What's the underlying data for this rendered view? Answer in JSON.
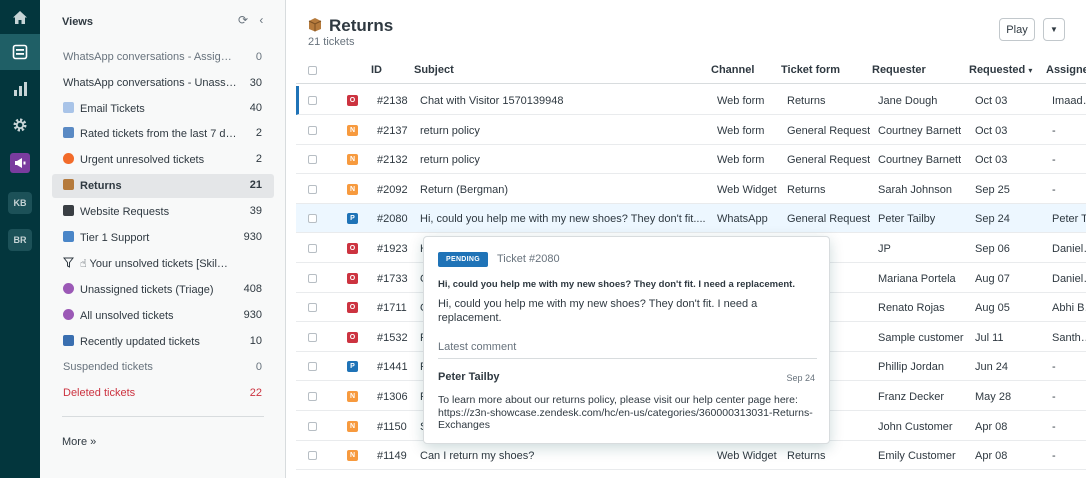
{
  "rail": {
    "kb": "KB",
    "br": "BR"
  },
  "views": {
    "title": "Views",
    "items": [
      {
        "label": "WhatsApp conversations - Assig…",
        "count": "0",
        "style": "muted"
      },
      {
        "label": "WhatsApp conversations - Unass…",
        "count": "30",
        "style": "plain"
      },
      {
        "label": "Email Tickets",
        "count": "40",
        "style": "plain",
        "icon": "email-icon"
      },
      {
        "label": "Rated tickets from the last 7 d…",
        "count": "2",
        "style": "plain",
        "icon": "chart-icon"
      },
      {
        "label": "Urgent unresolved tickets",
        "count": "2",
        "style": "plain",
        "icon": "fire-icon"
      },
      {
        "label": "Returns",
        "count": "21",
        "style": "selected",
        "icon": "package-icon"
      },
      {
        "label": "Website Requests",
        "count": "39",
        "style": "plain",
        "icon": "laptop-icon"
      },
      {
        "label": "Tier 1 Support",
        "count": "930",
        "style": "plain",
        "icon": "keycap-one-icon"
      },
      {
        "label": "☝ Your unsolved tickets [Skil…",
        "count": "",
        "style": "plain",
        "icon": "filter-icon"
      },
      {
        "label": "Unassigned tickets (Triage)",
        "count": "408",
        "style": "plain",
        "icon": "sparkle-icon"
      },
      {
        "label": "All unsolved tickets",
        "count": "930",
        "style": "plain",
        "icon": "sparkle-icon"
      },
      {
        "label": "Recently updated tickets",
        "count": "10",
        "style": "plain",
        "icon": "new-icon"
      },
      {
        "label": "Suspended tickets",
        "count": "0",
        "style": "muted"
      },
      {
        "label": "Deleted tickets",
        "count": "22",
        "style": "red"
      }
    ],
    "more": "More »"
  },
  "main": {
    "title": "Returns",
    "count": "21 tickets",
    "play": "Play"
  },
  "columns": [
    "ID",
    "Subject",
    "Channel",
    "Ticket form",
    "Requester",
    "Requested",
    "Assignee"
  ],
  "sort_indicator": "▾",
  "status_colors": {
    "O": "#cc3340",
    "N": "#f79a3e",
    "P": "#1f73b7"
  },
  "rows": [
    {
      "status": "O",
      "id": "#2138",
      "subject": "Chat with Visitor 1570139948",
      "channel": "Web form",
      "form": "Returns",
      "requester": "Jane Dough",
      "requested": "Oct 03",
      "assignee": "Imaadh S"
    },
    {
      "status": "N",
      "id": "#2137",
      "subject": "return policy",
      "channel": "Web form",
      "form": "General Request",
      "requester": "Courtney Barnett",
      "requested": "Oct 03",
      "assignee": "-"
    },
    {
      "status": "N",
      "id": "#2132",
      "subject": "return policy",
      "channel": "Web form",
      "form": "General Request",
      "requester": "Courtney Barnett",
      "requested": "Oct 03",
      "assignee": "-"
    },
    {
      "status": "N",
      "id": "#2092",
      "subject": "Return (Bergman)",
      "channel": "Web Widget",
      "form": "Returns",
      "requester": "Sarah Johnson",
      "requested": "Sep 25",
      "assignee": "-"
    },
    {
      "status": "P",
      "id": "#2080",
      "subject": "Hi, could you help me with my new shoes? They don't fit....",
      "channel": "WhatsApp",
      "form": "General Request",
      "requester": "Peter Tailby",
      "requested": "Sep 24",
      "assignee": "Peter Tai"
    },
    {
      "status": "O",
      "id": "#1923",
      "subject": "Hi",
      "channel": "",
      "form": "equest",
      "requester": "JP",
      "requested": "Sep 06",
      "assignee": "Daniel Ru"
    },
    {
      "status": "O",
      "id": "#1733",
      "subject": "Ol",
      "channel": "",
      "form": "atus",
      "requester": "Mariana Portela",
      "requested": "Aug 07",
      "assignee": "Daniel Ru"
    },
    {
      "status": "O",
      "id": "#1711",
      "subject": "Ol",
      "channel": "",
      "form": "",
      "requester": "Renato Rojas",
      "requested": "Aug 05",
      "assignee": "Abhi Bas"
    },
    {
      "status": "O",
      "id": "#1532",
      "subject": "Re",
      "channel": "",
      "form": "",
      "requester": "Sample customer",
      "requested": "Jul 11",
      "assignee": "Santhosh"
    },
    {
      "status": "P",
      "id": "#1441",
      "subject": "Fa",
      "channel": "",
      "form": "equest",
      "requester": "Phillip Jordan",
      "requested": "Jun 24",
      "assignee": "-"
    },
    {
      "status": "N",
      "id": "#1306",
      "subject": "Re",
      "channel": "",
      "form": "",
      "requester": "Franz Decker",
      "requested": "May 28",
      "assignee": "-"
    },
    {
      "status": "N",
      "id": "#1150",
      "subject": "Sh",
      "channel": "",
      "form": "",
      "requester": "John Customer",
      "requested": "Apr 08",
      "assignee": "-"
    },
    {
      "status": "N",
      "id": "#1149",
      "subject": "Can I return my shoes?",
      "channel": "Web Widget",
      "form": "Returns",
      "requester": "Emily Customer",
      "requested": "Apr 08",
      "assignee": "-"
    }
  ],
  "popover": {
    "status": "PENDING",
    "ticket": "Ticket #2080",
    "subject": "Hi, could you help me with my new shoes? They don't fit. I need a replacement.",
    "description": "Hi, could you help me with my new shoes? They don't fit. I need a replacement.",
    "latest_label": "Latest comment",
    "author": "Peter Tailby",
    "date": "Sep 24",
    "body": "To learn more about our returns policy, please visit our help center page here: https://z3n-showcase.zendesk.com/hc/en-us/categories/360000313031-Returns-Exchanges"
  }
}
